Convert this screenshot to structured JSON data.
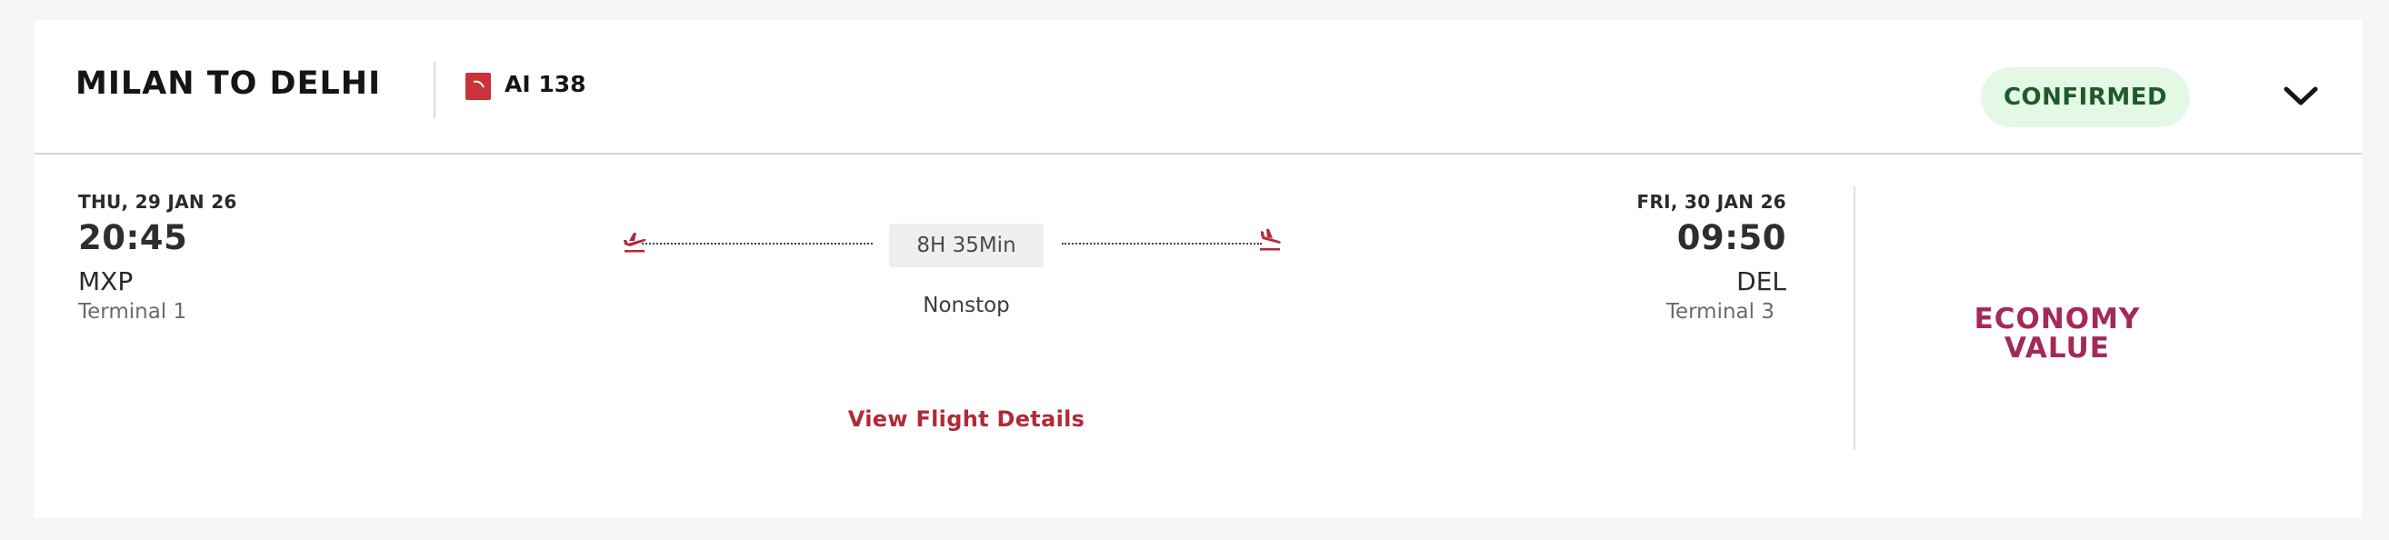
{
  "header": {
    "route_title": "MILAN TO DELHI",
    "flight_number": "AI 138",
    "status": "CONFIRMED",
    "status_colors": {
      "background": "#e3f9e6",
      "text": "#1f5a2c"
    },
    "airline_logo_icon": "air-india-logo-icon",
    "expand_icon": "chevron-down-icon"
  },
  "departure": {
    "date": "THU, 29 JAN 26",
    "time": "20:45",
    "airport_code": "MXP",
    "terminal": "Terminal 1",
    "icon": "takeoff-icon"
  },
  "arrival": {
    "date": "FRI, 30 JAN 26",
    "time": "09:50",
    "airport_code": "DEL",
    "terminal": "Terminal 3",
    "icon": "landing-icon"
  },
  "journey": {
    "duration": "8H 35Min",
    "stops": "Nonstop",
    "details_link": "View Flight Details"
  },
  "fare": {
    "line1": "ECONOMY",
    "line2": "VALUE"
  },
  "colors": {
    "accent": "#b22a35",
    "fare": "#a3295a",
    "logo": "#c8343a"
  }
}
